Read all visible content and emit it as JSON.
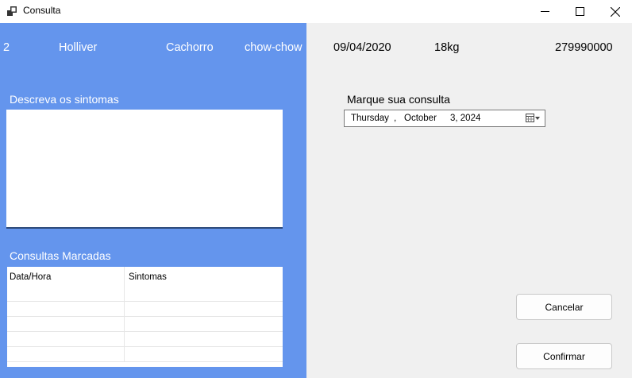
{
  "window": {
    "title": "Consulta",
    "minimize": "—",
    "maximize": "☐",
    "close": "✕"
  },
  "pet": {
    "id": "2",
    "name": "Holliver",
    "species": "Cachorro",
    "breed": "chow-chow",
    "birth_date": "09/04/2020",
    "weight": "18kg",
    "phone": "279990000"
  },
  "symptoms": {
    "label": "Descreva os sintomas",
    "value": ""
  },
  "appointments": {
    "label": "Consultas Marcadas",
    "columns": [
      "Data/Hora",
      "Sintomas"
    ],
    "rows": [
      [
        "",
        ""
      ],
      [
        "",
        ""
      ],
      [
        "",
        ""
      ],
      [
        "",
        ""
      ]
    ]
  },
  "schedule": {
    "label": "Marque sua consulta",
    "weekday": "Thursday",
    "sep1": ",",
    "month": "October",
    "day_year": "3, 2024"
  },
  "buttons": {
    "cancel": "Cancelar",
    "confirm": "Confirmar"
  },
  "colors": {
    "left_panel": "#6495ed",
    "background": "#f0f0f0"
  }
}
